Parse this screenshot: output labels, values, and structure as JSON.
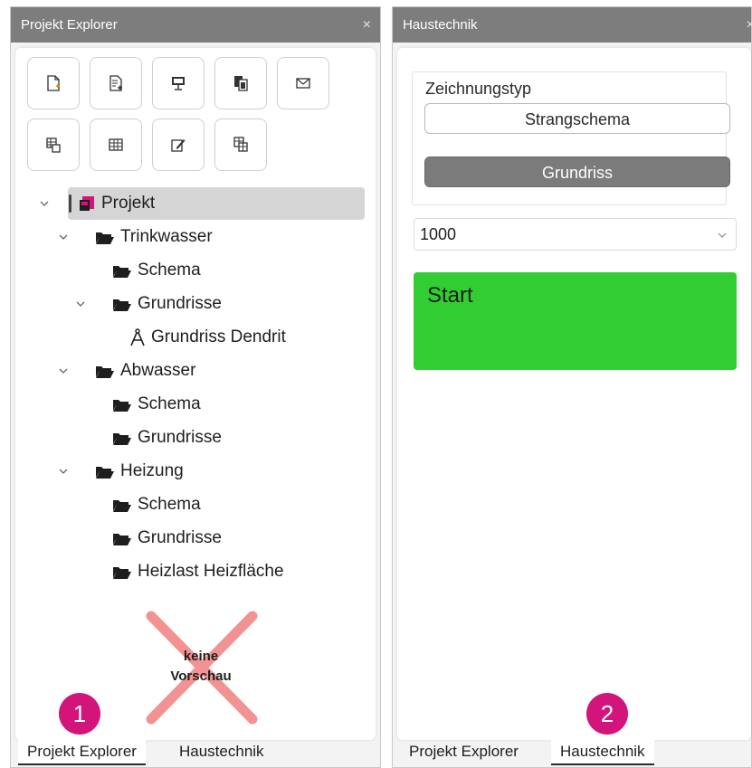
{
  "left_panel": {
    "title": "Projekt Explorer",
    "close_glyph": "×",
    "toolbar": [
      {
        "icon": "new-document-icon"
      },
      {
        "icon": "document-add-icon"
      },
      {
        "icon": "presentation-icon"
      },
      {
        "icon": "copy-document-icon"
      },
      {
        "icon": "mail-icon"
      },
      {
        "icon": "table-document-icon"
      },
      {
        "icon": "grid-icon"
      },
      {
        "icon": "edit-icon"
      },
      {
        "icon": "table-stack-icon"
      }
    ],
    "tree": {
      "root": "Projekt",
      "nodes": [
        {
          "label": "Trinkwasser",
          "children": [
            "Schema",
            "Grundrisse"
          ]
        },
        {
          "label": "Grundriss Dendrit"
        },
        {
          "label": "Abwasser",
          "children": [
            "Schema",
            "Grundrisse"
          ]
        },
        {
          "label": "Heizung",
          "children": [
            "Schema",
            "Grundrisse",
            "Heizlast Heizfläche"
          ]
        }
      ]
    },
    "preview": {
      "line1": "keine",
      "line2": "Vorschau"
    },
    "tabs": [
      "Projekt Explorer",
      "Haustechnik"
    ],
    "active_tab": "Projekt Explorer",
    "badge": "1"
  },
  "right_panel": {
    "title": "Haustechnik",
    "close_glyph": "×",
    "group_title": "Zeichnungstyp",
    "option_strangschema": "Strangschema",
    "option_grundriss": "Grundriss",
    "scale_value": "1000",
    "start_label": "Start",
    "tabs": [
      "Projekt Explorer",
      "Haustechnik"
    ],
    "active_tab": "Haustechnik",
    "badge": "2"
  },
  "colors": {
    "title_bar": "#7d7d7d",
    "start_green": "#32cd32",
    "badge_magenta": "#d3147a",
    "selected_option": "#7b7b7b"
  }
}
